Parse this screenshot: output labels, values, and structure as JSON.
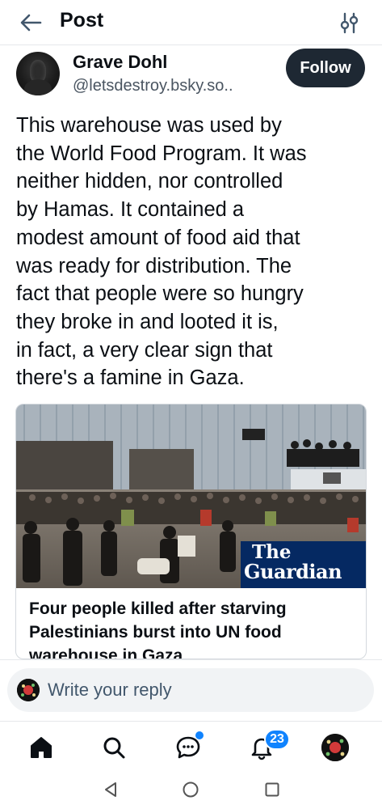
{
  "header": {
    "title": "Post"
  },
  "post": {
    "author_name": "Grave Dohl",
    "author_handle": "@letsdestroy.bsky.so..",
    "follow_label": "Follow",
    "text_lines": [
      "This warehouse was used by",
      "the World Food Program. It was",
      "neither hidden, nor controlled",
      "by Hamas. It contained a",
      "modest amount of food aid that",
      "was ready for distribution. The",
      "fact that people were so hungry",
      "they broke in and looted it is,",
      "in fact, a very clear sign that",
      "there's a famine in Gaza."
    ]
  },
  "link_card": {
    "logo_line1": "The",
    "logo_line2": "Guardian",
    "title_lines": [
      "Four people killed after starving",
      "Palestinians burst into UN food",
      "warehouse in Gaza"
    ],
    "colors": {
      "logo_bg": "#052962",
      "logo_text": "#ffffff"
    }
  },
  "reply": {
    "placeholder": "Write your reply"
  },
  "bottom_nav": {
    "items": [
      "home-icon",
      "search-icon",
      "chat-icon",
      "bell-icon",
      "profile-avatar"
    ],
    "notification_count": "23"
  },
  "colors": {
    "accent": "#1083fe",
    "follow_bg": "#1e2833",
    "text_primary": "#0b0f14",
    "text_secondary": "#4a5561"
  }
}
